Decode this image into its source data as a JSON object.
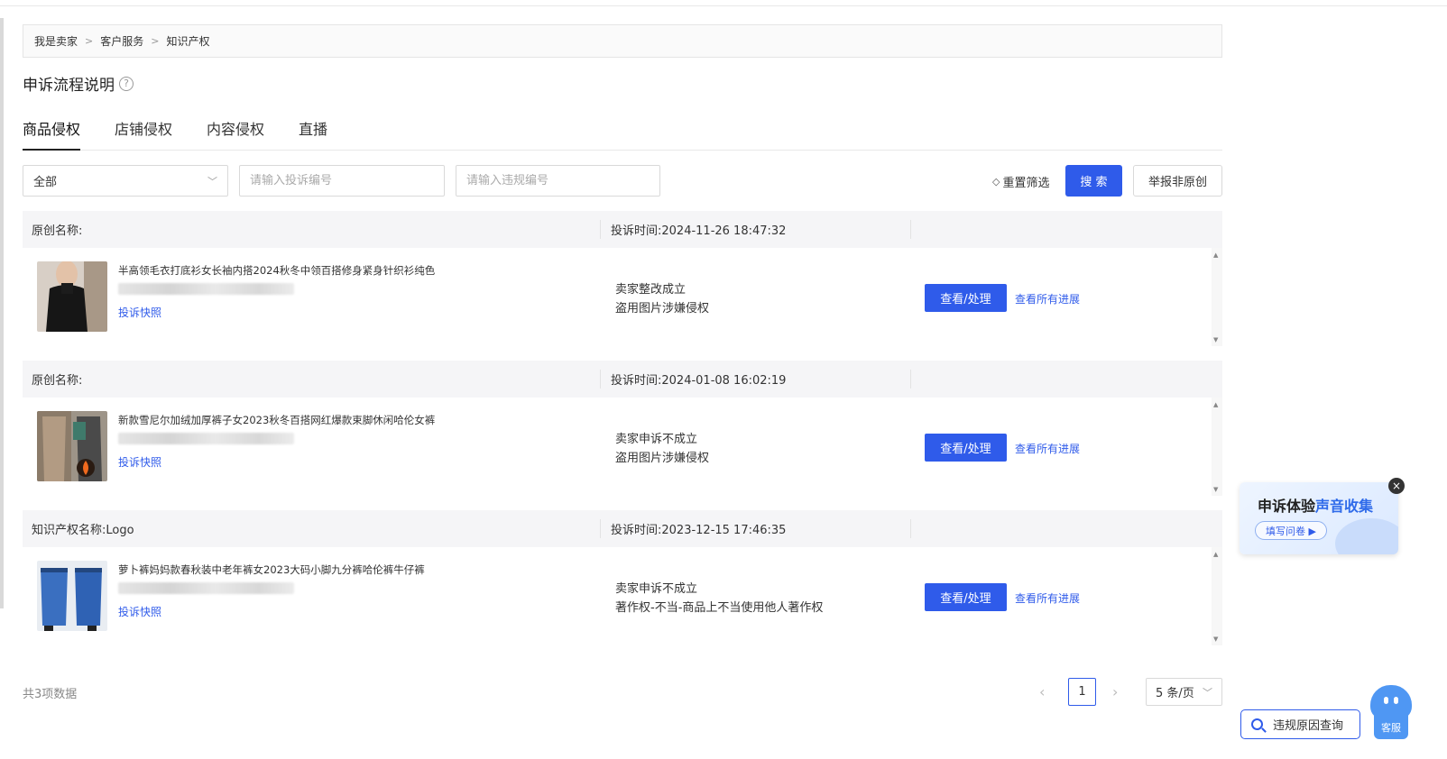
{
  "breadcrumb": [
    "我是卖家",
    "客户服务",
    "知识产权"
  ],
  "breadcrumb_sep": ">",
  "page_title": "申诉流程说明",
  "help_glyph": "?",
  "tabs": [
    "商品侵权",
    "店铺侵权",
    "内容侵权",
    "直播"
  ],
  "active_tab": 0,
  "filters": {
    "scope_value": "全部",
    "complaint_no_placeholder": "请输入投诉编号",
    "violation_no_placeholder": "请输入违规编号"
  },
  "actions": {
    "reset": "重置筛选",
    "search": "搜 索",
    "report_non_original": "举报非原创"
  },
  "records": [
    {
      "name_label": "原创名称:",
      "time_label": "投诉时间:2024-11-26 18:47:32",
      "product_title": "半高领毛衣打底衫女长袖内搭2024秋冬中领百搭修身紧身针织衫纯色",
      "snapshot": "投诉快照",
      "status": "卖家整改成立",
      "reason": "盗用图片涉嫌侵权",
      "view_button": "查看/处理",
      "progress_link": "查看所有进展"
    },
    {
      "name_label": "原创名称:",
      "time_label": "投诉时间:2024-01-08 16:02:19",
      "product_title": "新款雪尼尔加绒加厚裤子女2023秋冬百搭网红爆款束脚休闲哈伦女裤",
      "snapshot": "投诉快照",
      "status": "卖家申诉不成立",
      "reason": "盗用图片涉嫌侵权",
      "view_button": "查看/处理",
      "progress_link": "查看所有进展"
    },
    {
      "name_label": "知识产权名称:Logo",
      "time_label": "投诉时间:2023-12-15 17:46:35",
      "product_title": "萝卜裤妈妈款春秋装中老年裤女2023大码小脚九分裤哈伦裤牛仔裤",
      "snapshot": "投诉快照",
      "status": "卖家申诉不成立",
      "reason": "著作权-不当-商品上不当使用他人著作权",
      "view_button": "查看/处理",
      "progress_link": "查看所有进展"
    }
  ],
  "pagination": {
    "total": "共3项数据",
    "current_page": "1",
    "page_size": "5 条/页"
  },
  "survey": {
    "title_prefix": "申诉体验",
    "title_highlight": "声音收集",
    "button": "填写问卷 ▶"
  },
  "floating": {
    "violation_query": "违规原因查询",
    "customer_service": "客服"
  },
  "colors": {
    "primary": "#2f5bea",
    "card_header_bg": "#f5f5f7"
  }
}
